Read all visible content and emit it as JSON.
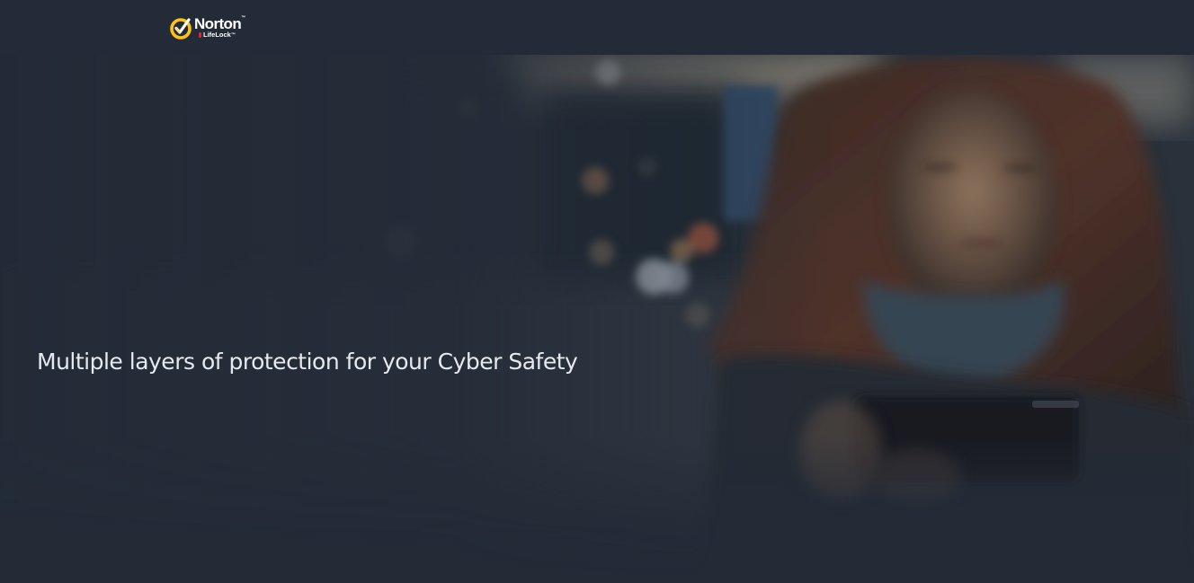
{
  "header": {
    "logo": {
      "brand": "Norton",
      "trademark": "™",
      "sub_brand": "LifeLock",
      "sub_trademark": "™",
      "icon": "norton-checkmark-icon",
      "accent_color": "#ffc20e"
    }
  },
  "hero": {
    "title": "Multiple layers of protection for your Cyber Safety",
    "image": "woman-looking-at-phone-at-night",
    "background_color": "#232b37"
  }
}
